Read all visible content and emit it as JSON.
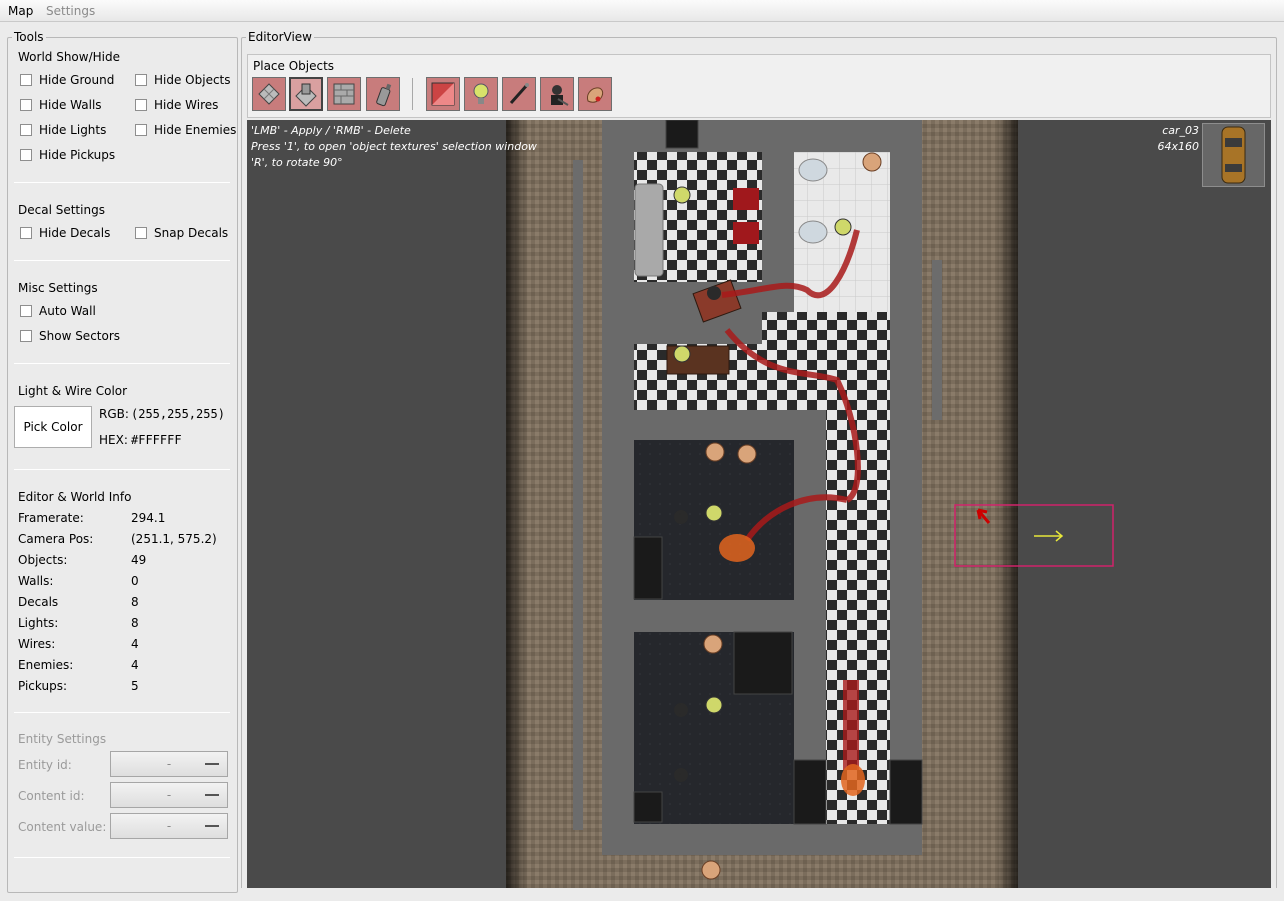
{
  "menu": {
    "items": [
      "Map",
      "Settings"
    ]
  },
  "tools": {
    "title": "Tools",
    "world_show_hide": {
      "title": "World Show/Hide",
      "options": [
        {
          "label": "Hide Ground",
          "checked": false
        },
        {
          "label": "Hide Objects",
          "checked": false
        },
        {
          "label": "Hide Walls",
          "checked": false
        },
        {
          "label": "Hide Wires",
          "checked": false
        },
        {
          "label": "Hide Lights",
          "checked": false
        },
        {
          "label": "Hide Enemies",
          "checked": false
        },
        {
          "label": "Hide Pickups",
          "checked": false
        }
      ]
    },
    "decal_settings": {
      "title": "Decal Settings",
      "options": [
        {
          "label": "Hide Decals",
          "checked": false
        },
        {
          "label": "Snap Decals",
          "checked": false
        }
      ]
    },
    "misc_settings": {
      "title": "Misc Settings",
      "options": [
        {
          "label": "Auto Wall",
          "checked": false
        },
        {
          "label": "Show Sectors",
          "checked": false
        }
      ]
    },
    "light_wire_color": {
      "title": "Light & Wire Color",
      "pick_button": "Pick Color",
      "rgb_label": "RGB:",
      "rgb_value": "(255,255,255)",
      "hex_label": "HEX:",
      "hex_value": "#FFFFFF"
    },
    "editor_world_info": {
      "title": "Editor & World Info",
      "rows": [
        {
          "label": "Framerate:",
          "value": "294.1"
        },
        {
          "label": "Camera Pos:",
          "value": "(251.1, 575.2)"
        },
        {
          "label": "Objects:",
          "value": "49"
        },
        {
          "label": "Walls:",
          "value": "0"
        },
        {
          "label": "Decals",
          "value": "8"
        },
        {
          "label": "Lights:",
          "value": "8"
        },
        {
          "label": "Wires:",
          "value": "4"
        },
        {
          "label": "Enemies:",
          "value": "4"
        },
        {
          "label": "Pickups:",
          "value": "5"
        }
      ]
    },
    "entity_settings": {
      "title": "Entity Settings",
      "fields": [
        {
          "label": "Entity id:",
          "value": "-"
        },
        {
          "label": "Content id:",
          "value": "-"
        },
        {
          "label": "Content value:",
          "value": "-"
        }
      ]
    }
  },
  "editor": {
    "title": "EditorView",
    "place_objects": {
      "title": "Place Objects",
      "buttons": [
        {
          "icon": "floor-tile-icon",
          "selected": false
        },
        {
          "icon": "object-tile-icon",
          "selected": true
        },
        {
          "icon": "wall-tile-icon",
          "selected": false
        },
        {
          "icon": "spray-can-icon",
          "selected": false
        },
        {
          "icon": "decal-icon",
          "selected": false
        },
        {
          "icon": "light-bulb-icon",
          "selected": false
        },
        {
          "icon": "wire-icon",
          "selected": false
        },
        {
          "icon": "enemy-icon",
          "selected": false
        },
        {
          "icon": "pickup-hand-icon",
          "selected": false
        }
      ]
    },
    "help_lines": [
      "'LMB' - Apply / 'RMB' - Delete",
      "Press '1', to open 'object textures' selection window",
      "'R', to rotate 90°"
    ],
    "object_name": "car_03",
    "object_size": "64x160"
  },
  "colors": {
    "selection_rect": "#d0226a",
    "cursor_arrow": "#cc0000",
    "direction_arrow": "#e8e83a"
  }
}
